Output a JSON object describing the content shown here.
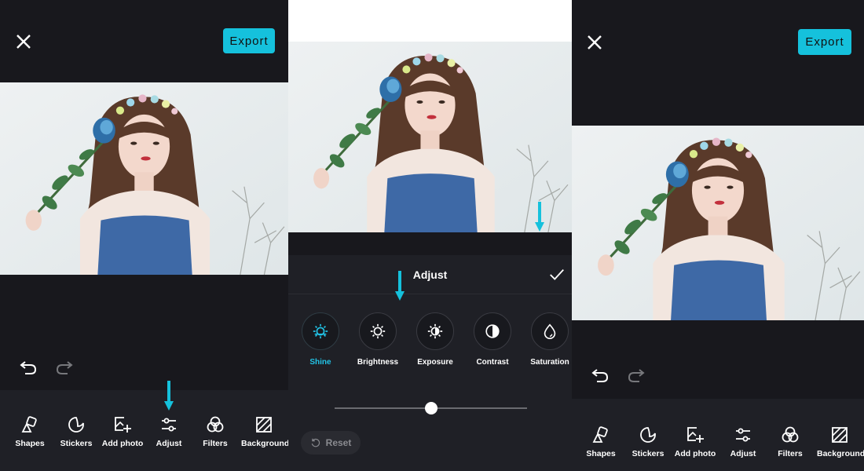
{
  "colors": {
    "accent": "#15c1dc",
    "background": "#18181d",
    "toolbar": "#1f2026",
    "active_label": "#22c3e6"
  },
  "left_screen": {
    "export_label": "Export",
    "close_icon": "close-icon",
    "undo_icon": "undo-icon",
    "redo_icon": "redo-icon",
    "tools": [
      {
        "label": "Shapes",
        "icon": "shapes-icon"
      },
      {
        "label": "Stickers",
        "icon": "sticker-icon"
      },
      {
        "label": "Add photo",
        "icon": "add-photo-icon"
      },
      {
        "label": "Adjust",
        "icon": "sliders-icon"
      },
      {
        "label": "Filters",
        "icon": "filters-icon"
      },
      {
        "label": "Background",
        "icon": "background-icon"
      }
    ]
  },
  "middle_screen": {
    "title": "Adjust",
    "confirm_icon": "check-icon",
    "options": [
      {
        "label": "Shine",
        "icon": "shine-icon",
        "active": true
      },
      {
        "label": "Brightness",
        "icon": "brightness-icon",
        "active": false
      },
      {
        "label": "Exposure",
        "icon": "exposure-icon",
        "active": false
      },
      {
        "label": "Contrast",
        "icon": "contrast-icon",
        "active": false
      },
      {
        "label": "Saturation",
        "icon": "saturation-icon",
        "active": false
      }
    ],
    "slider_value": 0.5,
    "reset_label": "Reset"
  },
  "right_screen": {
    "export_label": "Export",
    "tools": [
      {
        "label": "Shapes"
      },
      {
        "label": "Stickers"
      },
      {
        "label": "Add photo"
      },
      {
        "label": "Adjust"
      },
      {
        "label": "Filters"
      },
      {
        "label": "Background"
      }
    ]
  }
}
